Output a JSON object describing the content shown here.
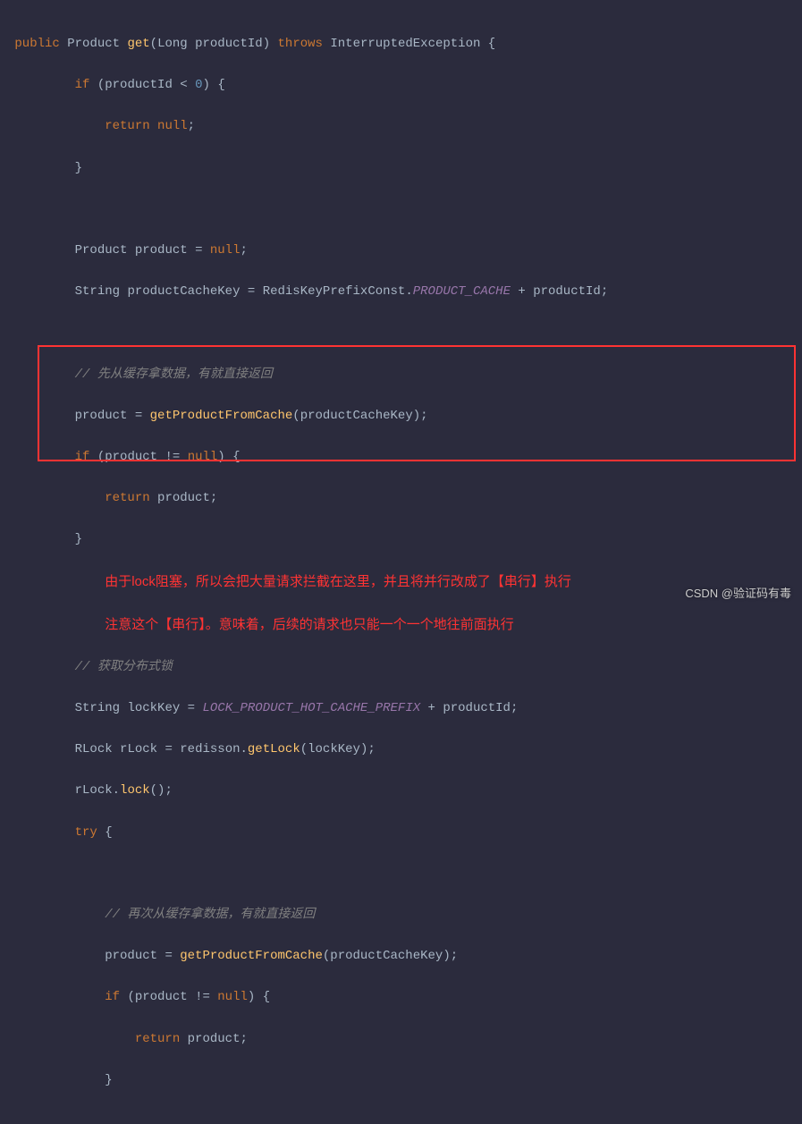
{
  "code": {
    "l1_public": "public",
    "l1_type": "Product",
    "l1_method": "get",
    "l1_paramtype": "Long",
    "l1_param": "productId",
    "l1_throws": "throws",
    "l1_exception": "InterruptedException",
    "l2_if": "if",
    "l2_cond_var": "productId",
    "l2_op": "<",
    "l2_num": "0",
    "l3_return": "return",
    "l3_null": "null",
    "l5_type": "Product",
    "l5_var": "product",
    "l5_null": "null",
    "l6_type": "String",
    "l6_var": "productCacheKey",
    "l6_class": "RedisKeyPrefixConst",
    "l6_field": "PRODUCT_CACHE",
    "l6_concat": "productId",
    "l7_comment": "// 先从缓存拿数据，有就直接返回",
    "l8_var": "product",
    "l8_method": "getProductFromCache",
    "l8_arg": "productCacheKey",
    "l9_if": "if",
    "l9_var": "product",
    "l9_null": "null",
    "l10_return": "return",
    "l10_var": "product",
    "annotation_line1": "由于lock阻塞，所以会把大量请求拦截在这里，并且将并行改成了【串行】执行",
    "annotation_line2": "注意这个【串行】。意味着，后续的请求也只能一个一个地往前面执行",
    "l12_comment": "// 获取分布式锁",
    "l13_type": "String",
    "l13_var": "lockKey",
    "l13_const": "LOCK_PRODUCT_HOT_CACHE_PREFIX",
    "l13_concat": "productId",
    "l14_type": "RLock",
    "l14_var": "rLock",
    "l14_obj": "redisson",
    "l14_method": "getLock",
    "l14_arg": "lockKey",
    "l15_obj": "rLock",
    "l15_method": "lock",
    "l16_try": "try",
    "l17_comment": "// 再次从缓存拿数据，有就直接返回",
    "l18_var": "product",
    "l18_method": "getProductFromCache",
    "l18_arg": "productCacheKey",
    "l19_if": "if",
    "l19_var": "product",
    "l19_null": "null",
    "l20_return": "return",
    "l20_var": "product"
  },
  "watermark": "CSDN @验证码有毒"
}
